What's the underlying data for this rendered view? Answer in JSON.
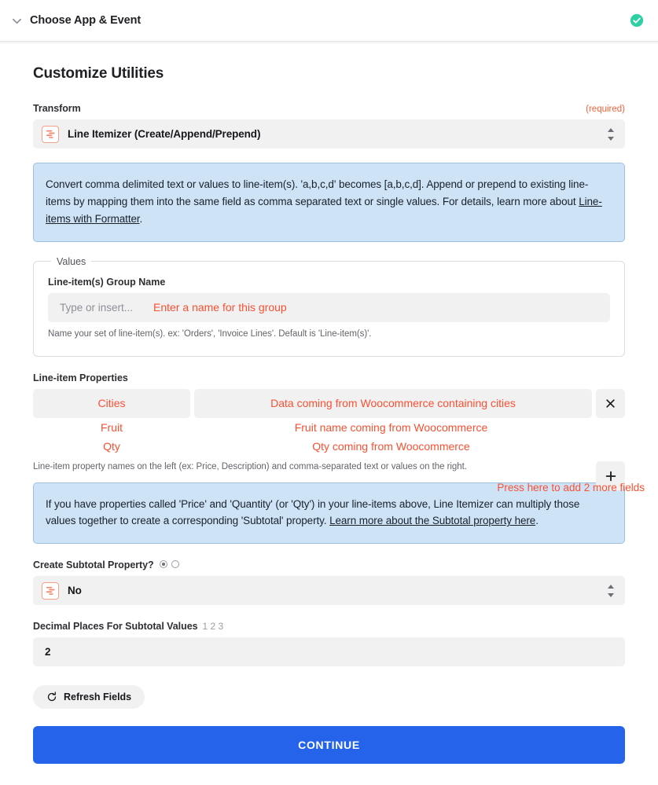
{
  "header": {
    "title": "Choose App & Event",
    "chevron_icon": "chevron-down-icon",
    "status_icon": "check-circle-icon",
    "status_color": "#2ecfa3"
  },
  "panel": {
    "title": "Customize Utilities"
  },
  "transform": {
    "label": "Transform",
    "required_note": "(required)",
    "value": "Line Itemizer (Create/Append/Prepend)",
    "app_icon": "formatter-line-itemizer-icon"
  },
  "callout_one": {
    "text_before": "Convert comma delimited text or values to line-item(s). 'a,b,c,d' becomes [a,b,c,d]. Append or prepend to existing line-items by mapping them into the same field as comma separated text or single values. For details, learn more about ",
    "link": "Line-items with Formatter",
    "text_after": "."
  },
  "values_group": {
    "legend": "Values",
    "group_name_label": "Line-item(s) Group Name",
    "group_name_placeholder": "Type or insert...",
    "group_name_annotation": "Enter a name for this group",
    "group_name_help": "Name your set of line-item(s). ex: 'Orders', 'Invoice Lines'. Default is 'Line-item(s)'."
  },
  "line_item_properties": {
    "label": "Line-item Properties",
    "rows": [
      {
        "key": "Cities",
        "value": "Data coming from Woocommerce containing cities",
        "filled": true
      },
      {
        "key": "Fruit",
        "value": "Fruit name coming from Woocommerce",
        "filled": false
      },
      {
        "key": "Qty",
        "value": "Qty coming from Woocommerce",
        "filled": false
      }
    ],
    "remove_icon": "close-icon",
    "add_icon": "plus-icon",
    "add_annotation": "Press here to add 2 more fields",
    "help": "Line-item property names on the left (ex: Price, Description) and comma-separated text or values on the right."
  },
  "callout_two": {
    "text_before": "If you have properties called 'Price' and 'Quantity' (or 'Qty') in your line-items above, Line Itemizer can multiply those values together to create a corresponding 'Subtotal' property. ",
    "link": "Learn more about the Subtotal property here",
    "text_after": "."
  },
  "subtotal": {
    "label": "Create Subtotal Property?",
    "value": "No",
    "app_icon": "formatter-line-itemizer-icon",
    "radio_selected_index": 0,
    "radio_count": 2
  },
  "decimal_places": {
    "label": "Decimal Places For Subtotal Values",
    "hint": "1 2 3",
    "value": "2"
  },
  "refresh": {
    "label": "Refresh Fields",
    "icon": "refresh-icon"
  },
  "continue": {
    "label": "CONTINUE",
    "color": "#2563eb"
  }
}
